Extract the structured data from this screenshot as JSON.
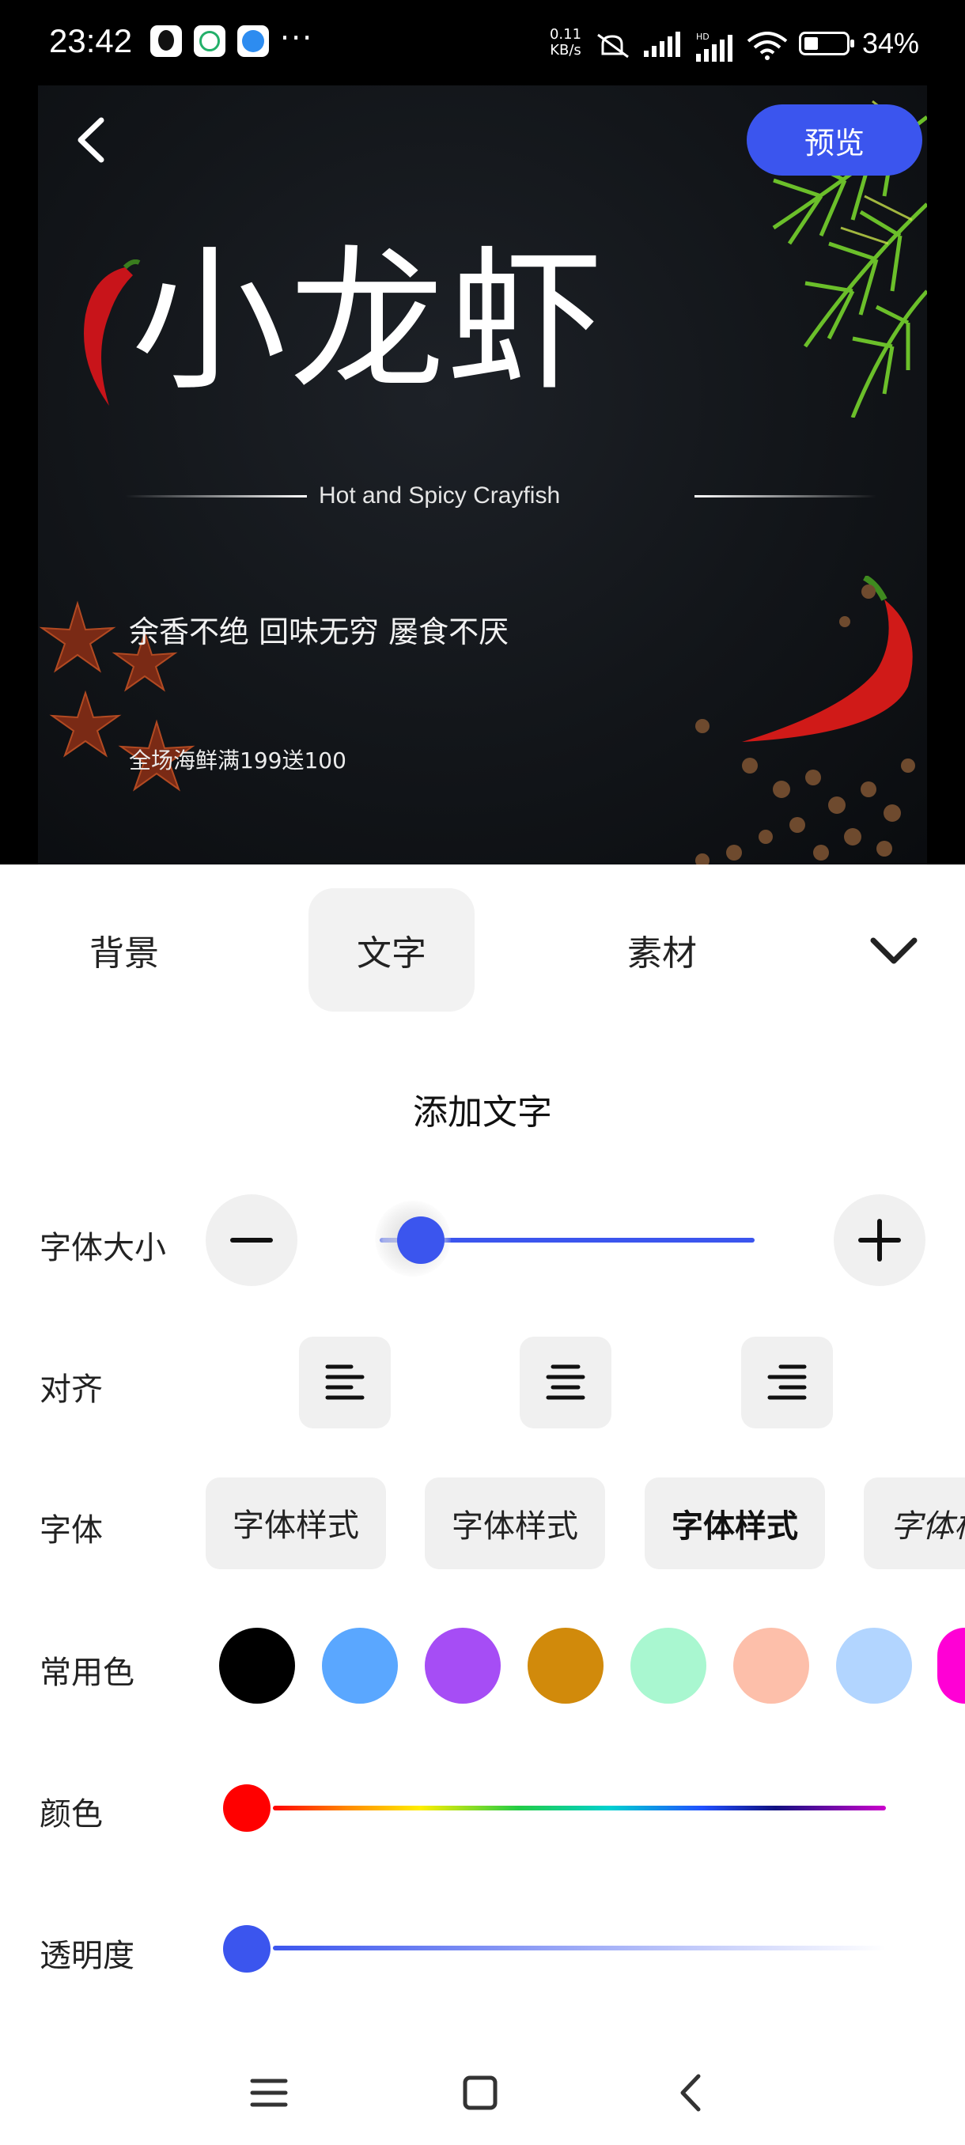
{
  "status_bar": {
    "time": "23:42",
    "net_speed_value": "0.11",
    "net_speed_unit": "KB/s",
    "signal_tag": "HD",
    "battery": "34%",
    "battery_level": 0.34,
    "more_label": "···"
  },
  "poster": {
    "title": "小龙虾",
    "subtitle": "Hot and Spicy Crayfish",
    "slogan": "余香不绝 回味无穷 屡食不厌",
    "promo": "全场海鲜满199送100"
  },
  "header": {
    "preview_label": "预览"
  },
  "tabs": [
    {
      "label": "背景",
      "active": false
    },
    {
      "label": "文字",
      "active": true
    },
    {
      "label": "素材",
      "active": false
    }
  ],
  "panel": {
    "title": "添加文字",
    "font_size": {
      "label": "字体大小",
      "value": 0.1
    },
    "align": {
      "label": "对齐"
    },
    "font": {
      "label": "字体",
      "options": [
        "字体样式",
        "字体样式",
        "字体样式",
        "字体样"
      ]
    },
    "common_colors": {
      "label": "常用色",
      "colors": [
        "#000000",
        "#5aa7ff",
        "#a64df5",
        "#d18a0b",
        "#a9f7d0",
        "#fdbfaa",
        "#b2d5ff",
        "#ff00d5"
      ]
    },
    "color": {
      "label": "颜色",
      "selected": "#ff0000"
    },
    "opacity": {
      "label": "透明度",
      "value": 0.0
    }
  },
  "theme": {
    "accent": "#3b55ee"
  }
}
